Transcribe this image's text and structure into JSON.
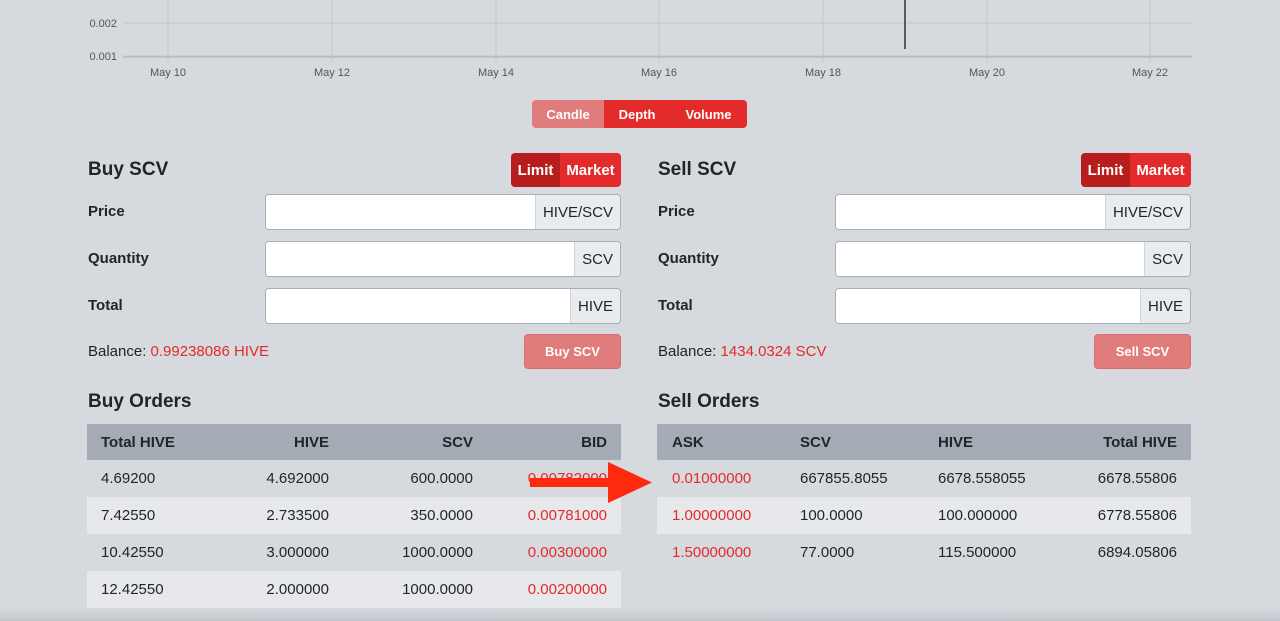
{
  "chart_data": {
    "type": "bar",
    "x_ticks": [
      "May 10",
      "May 12",
      "May 14",
      "May 16",
      "May 18",
      "May 20",
      "May 22"
    ],
    "y_ticks": [
      "0.002",
      "0.001"
    ],
    "grid": true
  },
  "chart_toggle": {
    "candle": "Candle",
    "depth": "Depth",
    "volume": "Volume"
  },
  "buy": {
    "title": "Buy SCV",
    "limit": "Limit",
    "market": "Market",
    "price_label": "Price",
    "price_unit": "HIVE/SCV",
    "quantity_label": "Quantity",
    "quantity_unit": "SCV",
    "total_label": "Total",
    "total_unit": "HIVE",
    "balance_label": "Balance:",
    "balance_value": "0.99238086 HIVE",
    "submit": "Buy SCV"
  },
  "sell": {
    "title": "Sell SCV",
    "limit": "Limit",
    "market": "Market",
    "price_label": "Price",
    "price_unit": "HIVE/SCV",
    "quantity_label": "Quantity",
    "quantity_unit": "SCV",
    "total_label": "Total",
    "total_unit": "HIVE",
    "balance_label": "Balance:",
    "balance_value": "1434.0324 SCV",
    "submit": "Sell SCV"
  },
  "buy_orders": {
    "title": "Buy Orders",
    "headers": [
      "Total HIVE",
      "HIVE",
      "SCV",
      "BID"
    ],
    "rows": [
      [
        "4.69200",
        "4.692000",
        "600.0000",
        "0.00782000"
      ],
      [
        "7.42550",
        "2.733500",
        "350.0000",
        "0.00781000"
      ],
      [
        "10.42550",
        "3.000000",
        "1000.0000",
        "0.00300000"
      ],
      [
        "12.42550",
        "2.000000",
        "1000.0000",
        "0.00200000"
      ]
    ]
  },
  "sell_orders": {
    "title": "Sell Orders",
    "headers": [
      "ASK",
      "SCV",
      "HIVE",
      "Total HIVE"
    ],
    "rows": [
      [
        "0.01000000",
        "667855.8055",
        "6678.558055",
        "6678.55806"
      ],
      [
        "1.00000000",
        "100.0000",
        "100.000000",
        "6778.55806"
      ],
      [
        "1.50000000",
        "77.0000",
        "115.500000",
        "6894.05806"
      ]
    ]
  },
  "colors": {
    "accent": "#e42b2b",
    "accent_dark": "#b81d1d",
    "accent_light": "#e07c7c",
    "header": "#a4abb5"
  }
}
